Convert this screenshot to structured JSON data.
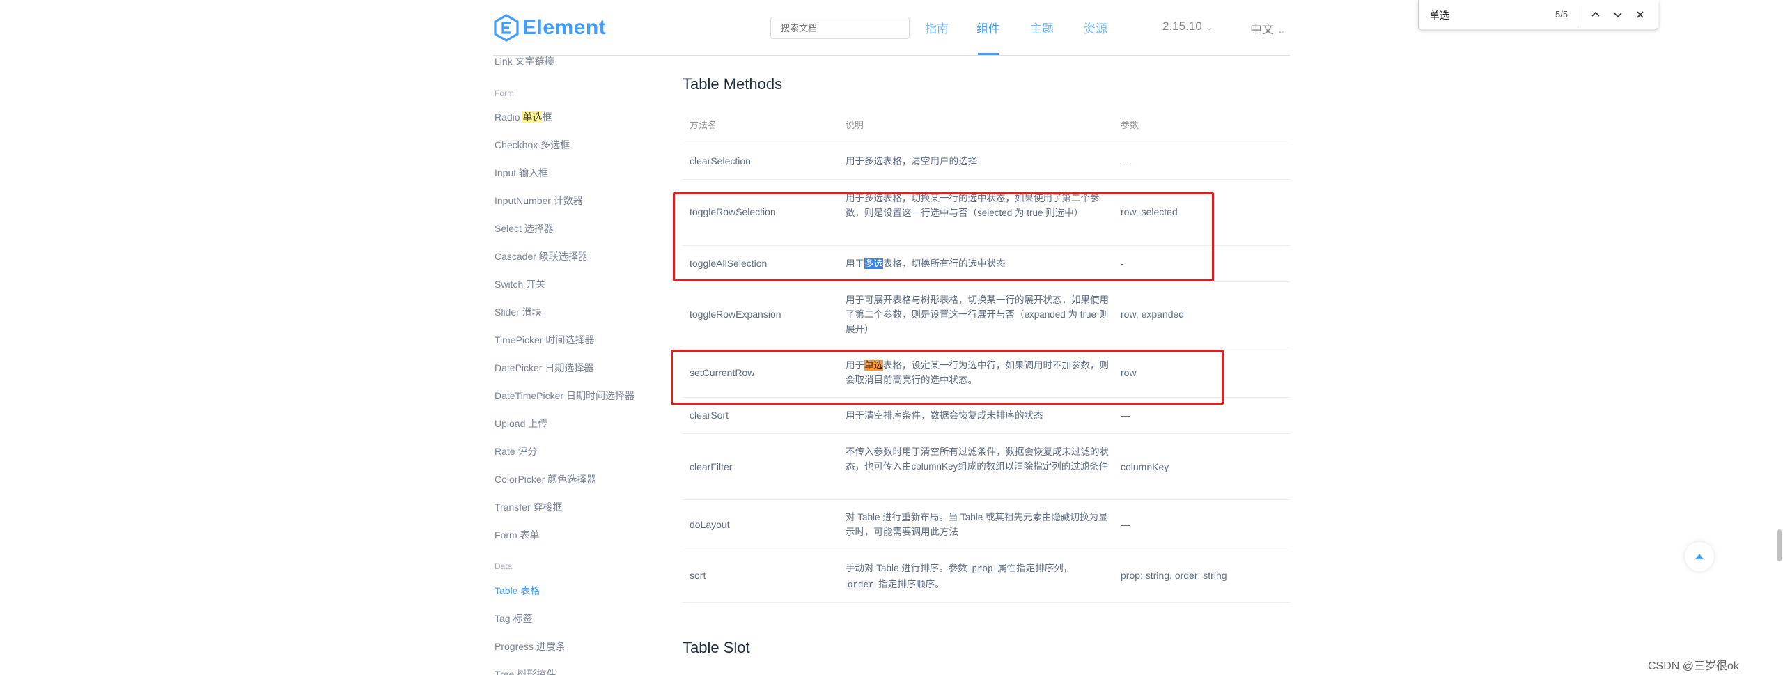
{
  "header": {
    "logo_text": "Element",
    "search_placeholder": "搜索文档",
    "nav": [
      "指南",
      "组件",
      "主题",
      "资源"
    ],
    "version": "2.15.10",
    "language": "中文"
  },
  "findbar": {
    "query": "单选",
    "count": "5/5"
  },
  "sidebar": {
    "top_item": "Link 文字链接",
    "group_form": "Form",
    "radio_prefix": "Radio ",
    "radio_match": "单选",
    "radio_suffix": "框",
    "items_form": [
      "Checkbox 多选框",
      "Input 输入框",
      "InputNumber 计数器",
      "Select 选择器",
      "Cascader 级联选择器",
      "Switch 开关",
      "Slider 滑块",
      "TimePicker 时间选择器",
      "DatePicker 日期选择器",
      "DateTimePicker 日期时间选择器",
      "Upload 上传",
      "Rate 评分",
      "ColorPicker 颜色选择器",
      "Transfer 穿梭框",
      "Form 表单"
    ],
    "group_data": "Data",
    "items_data": [
      "Table 表格",
      "Tag 标签",
      "Progress 进度条",
      "Tree 树形控件"
    ]
  },
  "content": {
    "section_title": "Table Methods",
    "next_section_title": "Table Slot",
    "columns": [
      "方法名",
      "说明",
      "参数"
    ],
    "rows": {
      "clearSelection": {
        "name": "clearSelection",
        "desc": "用于多选表格，清空用户的选择",
        "params": "—"
      },
      "toggleRowSelection": {
        "name": "toggleRowSelection",
        "desc": "用于多选表格，切换某一行的选中状态，如果使用了第二个参数，则是设置这一行选中与否（selected 为 true 则选中）",
        "params": "row, selected"
      },
      "toggleAllSelection": {
        "name": "toggleAllSelection",
        "desc_pre": "用于",
        "desc_match": "多选",
        "desc_post": "表格，切换所有行的选中状态",
        "params": "-"
      },
      "toggleRowExpansion": {
        "name": "toggleRowExpansion",
        "desc": "用于可展开表格与树形表格，切换某一行的展开状态，如果使用了第二个参数，则是设置这一行展开与否（expanded 为 true 则展开）",
        "params": "row, expanded"
      },
      "setCurrentRow": {
        "name": "setCurrentRow",
        "desc_pre": "用于",
        "desc_match": "单选",
        "desc_post": "表格，设定某一行为选中行，如果调用时不加参数，则会取消目前高亮行的选中状态。",
        "params": "row"
      },
      "clearSort": {
        "name": "clearSort",
        "desc": "用于清空排序条件，数据会恢复成未排序的状态",
        "params": "—"
      },
      "clearFilter": {
        "name": "clearFilter",
        "desc": "不传入参数时用于清空所有过滤条件，数据会恢复成未过滤的状态，也可传入由columnKey组成的数组以清除指定列的过滤条件",
        "params": "columnKey"
      },
      "doLayout": {
        "name": "doLayout",
        "desc": "对 Table 进行重新布局。当 Table 或其祖先元素由隐藏切换为显示时，可能需要调用此方法",
        "params": "—"
      },
      "sort": {
        "name": "sort",
        "desc_a": "手动对 Table 进行排序。参数 ",
        "code_prop": "prop",
        "desc_b": " 属性指定排序列，",
        "code_order": "order",
        "desc_c": " 指定排序顺序。",
        "params": "prop: string, order: string"
      }
    }
  },
  "watermark": "CSDN @三岁很ok",
  "colors": {
    "brand": "#409eff",
    "annotation": "#e02020"
  }
}
